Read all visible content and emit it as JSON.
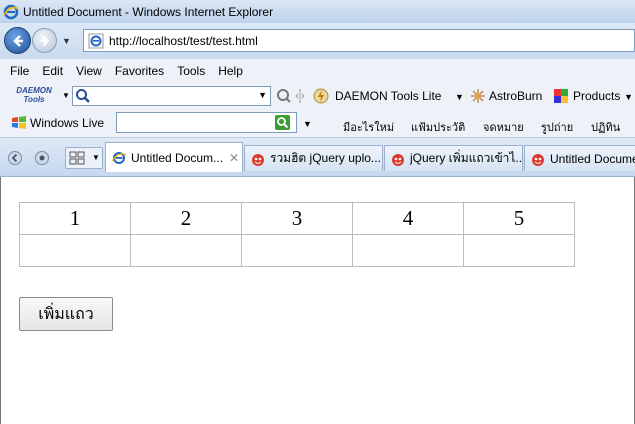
{
  "window": {
    "title": "Untitled Document - Windows Internet Explorer"
  },
  "address": {
    "url": "http://localhost/test/test.html"
  },
  "menu": {
    "items": [
      "File",
      "Edit",
      "View",
      "Favorites",
      "Tools",
      "Help"
    ]
  },
  "toolbar1": {
    "daemon_logo_line1": "DAEMON",
    "daemon_logo_line2": "Tools",
    "daemon_lite": "DAEMON Tools Lite",
    "astroburn": "AstroBurn",
    "products": "Products"
  },
  "toolbar2": {
    "windows_live": "Windows Live",
    "links": [
      "มีอะไรใหม่",
      "แฟ้มประวัติ",
      "จดหมาย",
      "รูปถ่าย",
      "ปฏิทิน"
    ]
  },
  "tabs": [
    {
      "label": "Untitled Docum...",
      "active": true
    },
    {
      "label": "รวมฮิต jQuery uplo...",
      "active": false
    },
    {
      "label": "jQuery เพิ่มแถวเข้าไ...",
      "active": false
    },
    {
      "label": "Untitled Docume",
      "active": false
    }
  ],
  "page": {
    "table_header": [
      "1",
      "2",
      "3",
      "4",
      "5"
    ],
    "table_row2": [
      "",
      "",
      "",
      "",
      ""
    ],
    "add_row_button": "เพิ่มแถว"
  },
  "colors": {
    "title_bar": "#bdd2ec",
    "toolbar_bg": "#eef2f8",
    "link_blue": "#2c4d9a"
  }
}
